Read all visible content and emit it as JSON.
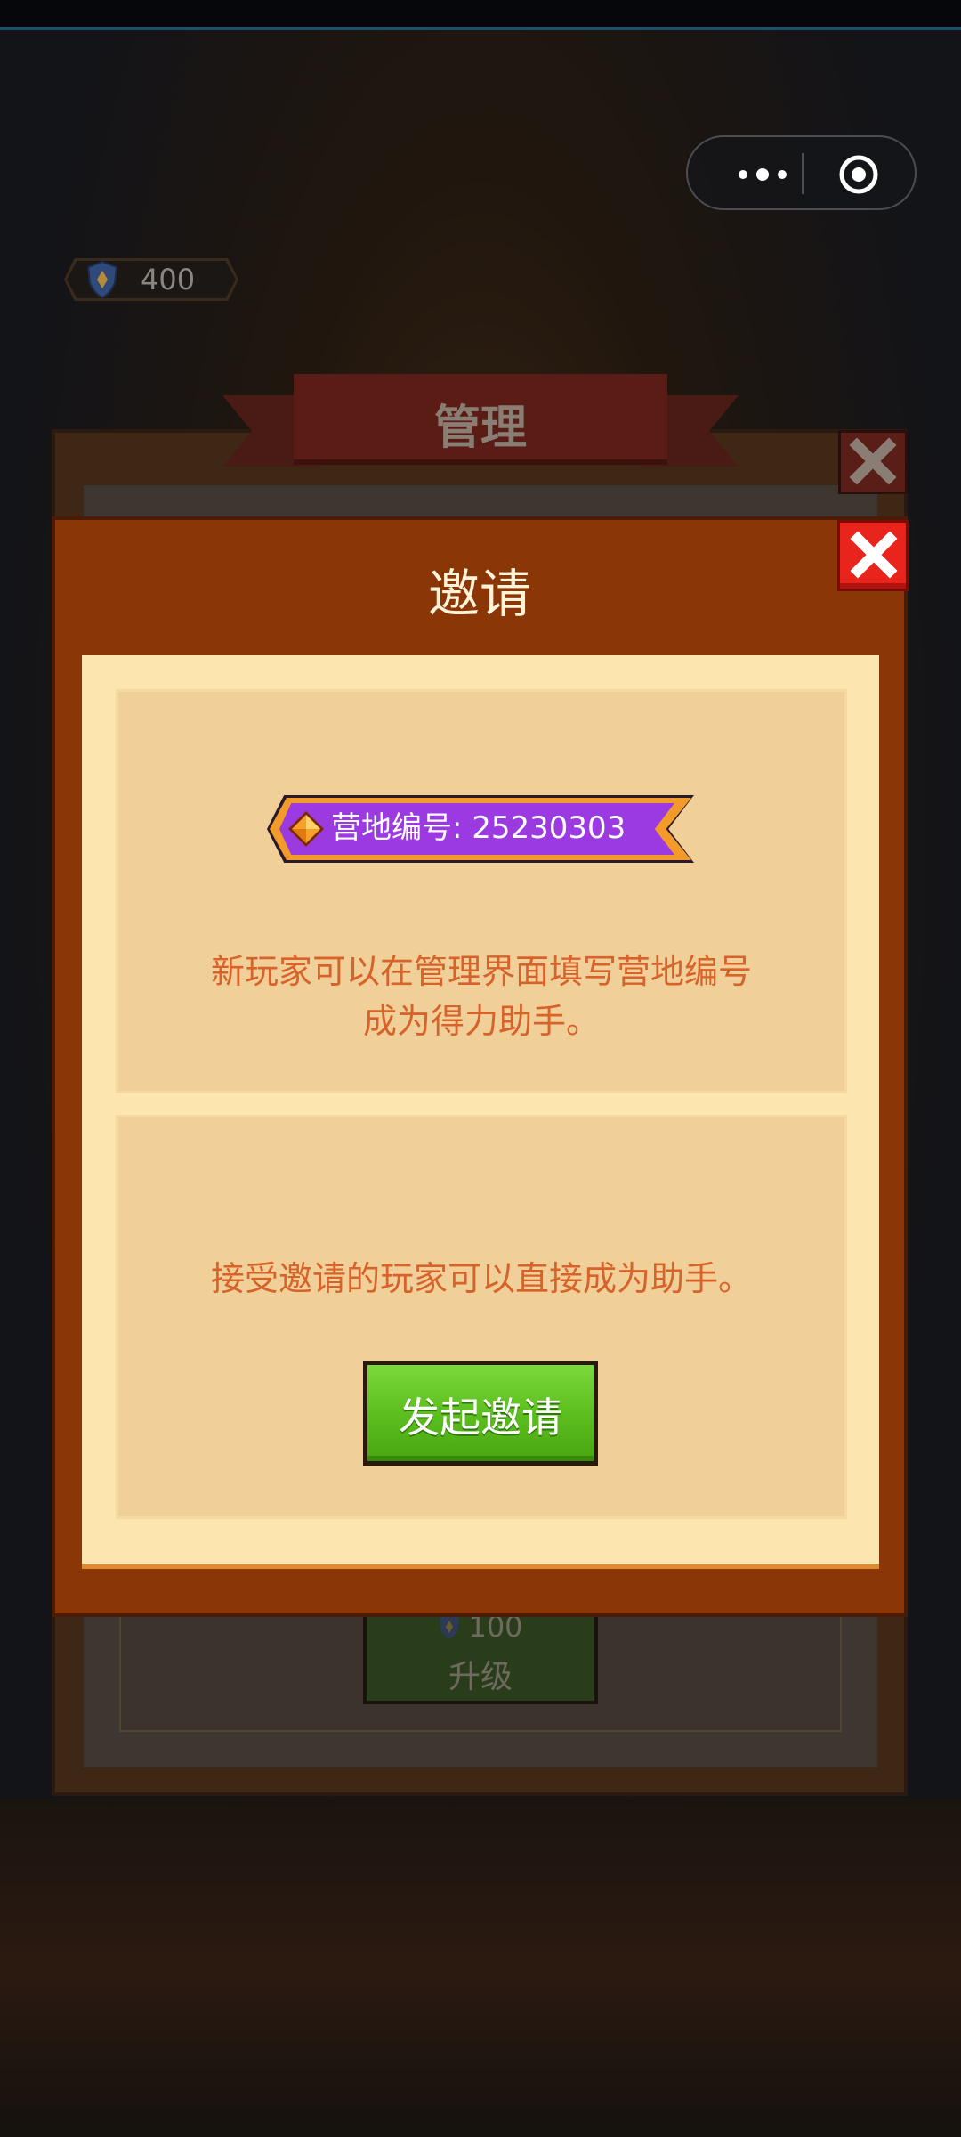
{
  "hud": {
    "currency_value": "400",
    "currency_icon": "shield-coin-icon"
  },
  "background_panel": {
    "title": "管理",
    "upgrade_cost": "100",
    "upgrade_label": "升级"
  },
  "invite_dialog": {
    "title": "邀请",
    "camp_id_text": "营地编号: 25230303",
    "description_1_line1": "新玩家可以在管理界面填写营地编号",
    "description_1_line2": "成为得力助手。",
    "description_2": "接受邀请的玩家可以直接成为助手。",
    "invite_button_label": "发起邀请"
  },
  "colors": {
    "dialog_frame": "#8a3606",
    "dialog_body": "#fde5b0",
    "card": "#f0cf98",
    "text_orange": "#d7632a",
    "button_green": "#5cbe1e",
    "close_red": "#e8241c",
    "camp_id_purple": "#9a3ae0"
  }
}
